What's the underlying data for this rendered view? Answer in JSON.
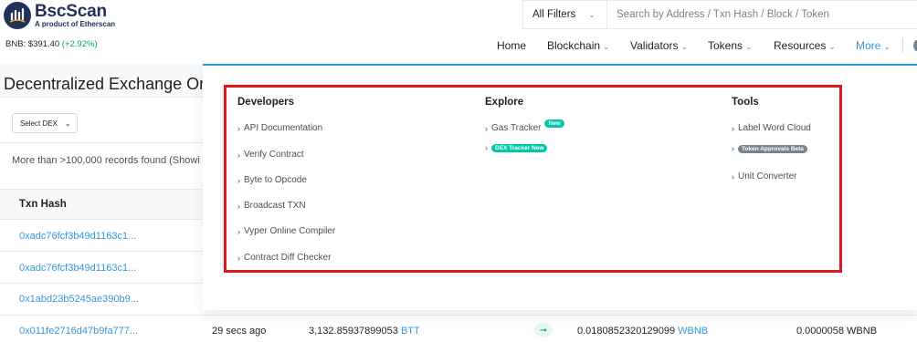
{
  "header": {
    "logo_title": "BscScan",
    "logo_subtitle": "A product of Etherscan",
    "price_label": "BNB: $391.40",
    "price_change": "(+2.92%)"
  },
  "search": {
    "filter_label": "All Filters",
    "placeholder": "Search by Address / Txn Hash / Block / Token"
  },
  "nav": {
    "home": "Home",
    "blockchain": "Blockchain",
    "validators": "Validators",
    "tokens": "Tokens",
    "resources": "Resources",
    "more": "More"
  },
  "page": {
    "title": "Decentralized Exchange Orde",
    "select_dex": "Select DEX",
    "records_text": "More than >100,000 records found (Showi",
    "col_txn_hash": "Txn Hash"
  },
  "rows": [
    {
      "hash": "0xadc76fcf3b49d1163c1..."
    },
    {
      "hash": "0xadc76fcf3b49d1163c1..."
    },
    {
      "hash": "0x1abd23b5245ae390b9..."
    },
    {
      "hash": "0x011fe2716d47b9fa777...",
      "age": "29 secs ago",
      "amount_out": "3,132.85937899053",
      "token_out": "BTT",
      "amount_in": "0.0180852320129099",
      "token_in": "WBNB",
      "price": "0.0000058 WBNB"
    }
  ],
  "mega_menu": {
    "developers": {
      "heading": "Developers",
      "items": [
        "API Documentation",
        "Verify Contract",
        "Byte to Opcode",
        "Broadcast TXN",
        "Vyper Online Compiler",
        "Contract Diff Checker"
      ]
    },
    "explore": {
      "heading": "Explore",
      "gas_tracker": "Gas Tracker",
      "gas_badge": "New",
      "dex_tracker_badge": "DEX Tracker New"
    },
    "tools": {
      "heading": "Tools",
      "label_word_cloud": "Label Word Cloud",
      "token_approvals_badge": "Token Approvals Beta",
      "unit_converter": "Unit Converter"
    }
  }
}
